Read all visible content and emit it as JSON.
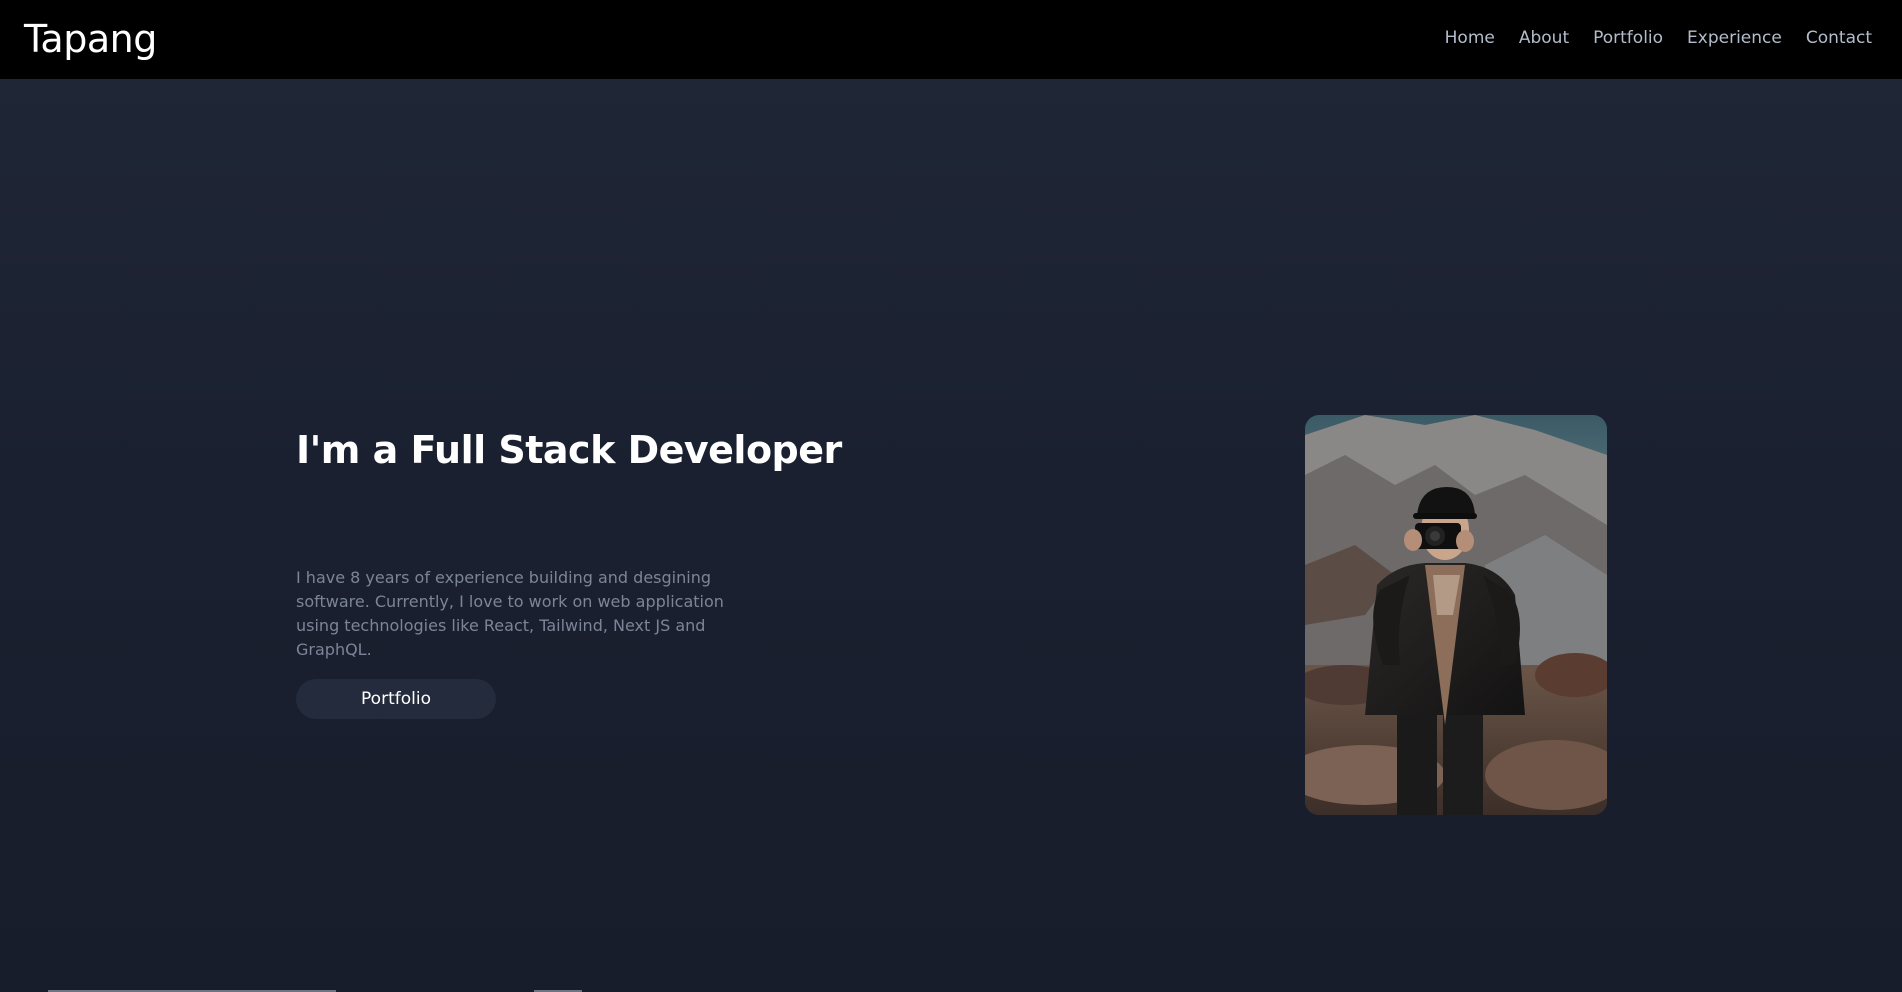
{
  "brand": "Tapang",
  "nav": {
    "items": [
      "Home",
      "About",
      "Portfolio",
      "Experience",
      "Contact"
    ]
  },
  "hero": {
    "headline": "I'm a Full Stack Developer",
    "description": "I have 8 years of experience building and desgining software. Currently, I love to work on web application using technologies like React, Tailwind, Next JS and GraphQL.",
    "button_label": "Portfolio",
    "image_alt": "Photographer holding a camera in a mountain landscape"
  },
  "colors": {
    "navbar_bg": "#000000",
    "page_bg": "#1b2130",
    "headline": "#ffffff",
    "body_text": "#7c8596",
    "nav_link": "#b3bccb",
    "button_bg": "#232b3c"
  }
}
